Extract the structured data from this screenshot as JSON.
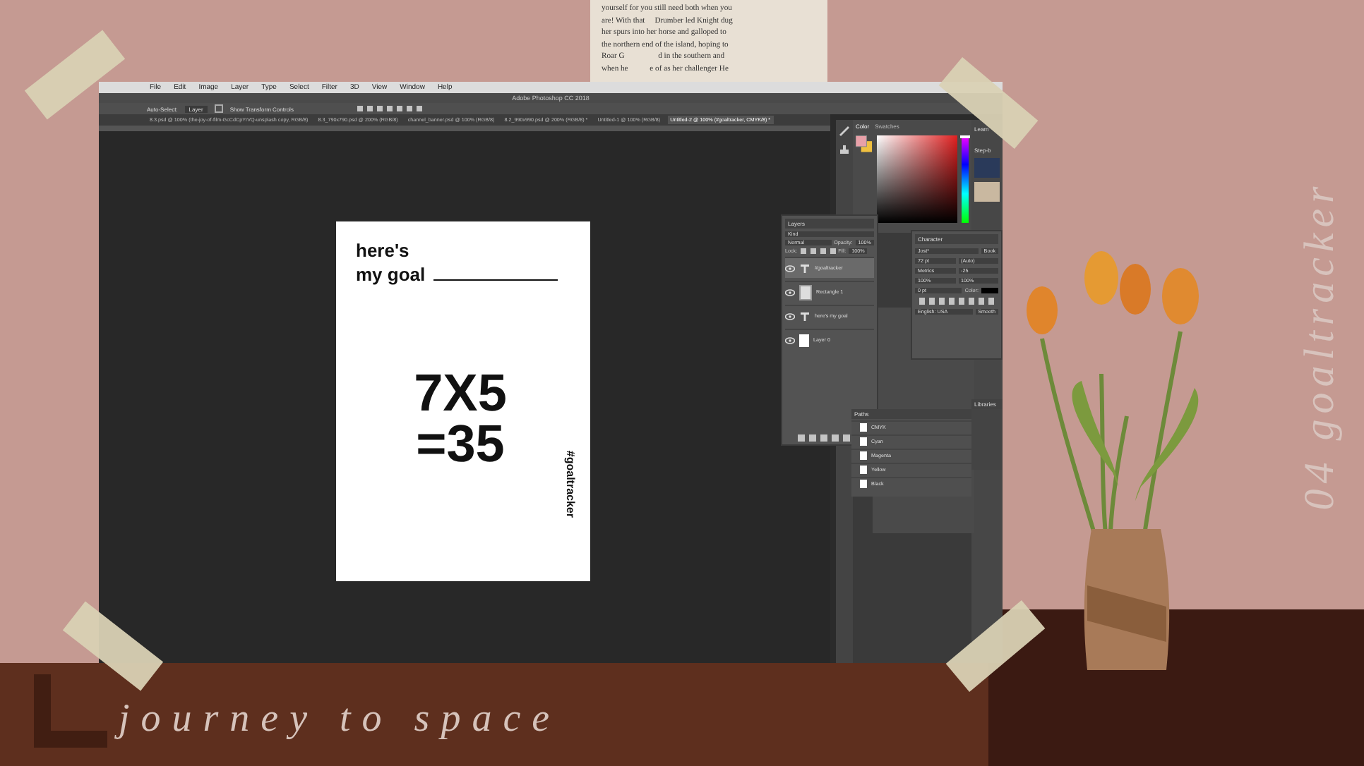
{
  "wall_texts": {
    "headline": "journey to space",
    "side_title": "04 goaltracker"
  },
  "newspaper": {
    "lines": [
      "yourself for you still need both when you",
      "are! With that     Drumber led Knight dug",
      "her spurs into her horse and galloped to",
      "the northern end of the island, hoping to",
      "Roar G                 d in the southern and",
      "when he           e of as her challenger He"
    ]
  },
  "photoshop": {
    "menu": [
      "File",
      "Edit",
      "Image",
      "Layer",
      "Type",
      "Select",
      "Filter",
      "3D",
      "View",
      "Window",
      "Help"
    ],
    "title": "Adobe Photoshop CC 2018",
    "options": {
      "auto_select": "Auto-Select:",
      "target": "Layer",
      "transform": "Show Transform Controls",
      "transform_checked": false
    },
    "tabs": [
      {
        "label": "8.3.psd @ 100% (the-joy-of-film-GcCdCpYrVQ-unsplash copy, RGB/8)",
        "selected": false
      },
      {
        "label": "8.3_790x790.psd @ 200% (RGB/8)",
        "selected": false
      },
      {
        "label": "channel_banner.psd @ 100% (RGB/8)",
        "selected": false
      },
      {
        "label": "8.2_990x990.psd @ 200% (RGB/8) *",
        "selected": false
      },
      {
        "label": "Untitled-1 @ 100% (RGB/8)",
        "selected": false
      },
      {
        "label": "Untitled-2 @ 100% (#goaltracker, CMYK/8) *",
        "selected": true
      }
    ],
    "document": {
      "line_1": "here's",
      "line_2": "my goal",
      "equation_1": "7X5",
      "equation_2": "=35",
      "hashtag": "#goaltracker"
    },
    "color_panel": {
      "hue": {
        "level": 0.97
      },
      "tabs": [
        {
          "label": "Color",
          "selected": true
        },
        {
          "label": "Swatches",
          "selected": false
        }
      ]
    },
    "learn_panel": {
      "title": "Learn",
      "subtitle": "Step-b"
    },
    "layers_panel": {
      "title": "Layers",
      "filter": "Kind",
      "blend": "Normal",
      "opacity_label": "Opacity:",
      "opacity": "100%",
      "lock_label": "Lock:",
      "fill_label": "Fill:",
      "fill": "100%",
      "layers": [
        {
          "name": "#goaltracker",
          "kind": "text",
          "selected": true
        },
        {
          "name": "Rectangle 1",
          "kind": "shape",
          "selected": false
        },
        {
          "name": "here's my goal",
          "kind": "text",
          "selected": false
        },
        {
          "name": "Layer 0",
          "kind": "image",
          "selected": false
        }
      ]
    },
    "character_panel": {
      "title": "Character",
      "font": "Jost*",
      "style": "Book",
      "size": "72 pt",
      "leading": "(Auto)",
      "kerning": "Metrics",
      "tracking": "-25",
      "vscale": "100%",
      "hscale": "100%",
      "baseline": "0 pt",
      "color_label": "Color:",
      "language": "English: USA",
      "antialias": "Smooth"
    },
    "channels_panel": {
      "title": "Paths",
      "channels": [
        {
          "name": "CMYK",
          "selected": false
        },
        {
          "name": "Cyan",
          "selected": false
        },
        {
          "name": "Magenta",
          "selected": false
        },
        {
          "name": "Yellow",
          "selected": false
        },
        {
          "name": "Black",
          "selected": false
        }
      ]
    },
    "libraries_panel": {
      "title": "Libraries"
    }
  }
}
